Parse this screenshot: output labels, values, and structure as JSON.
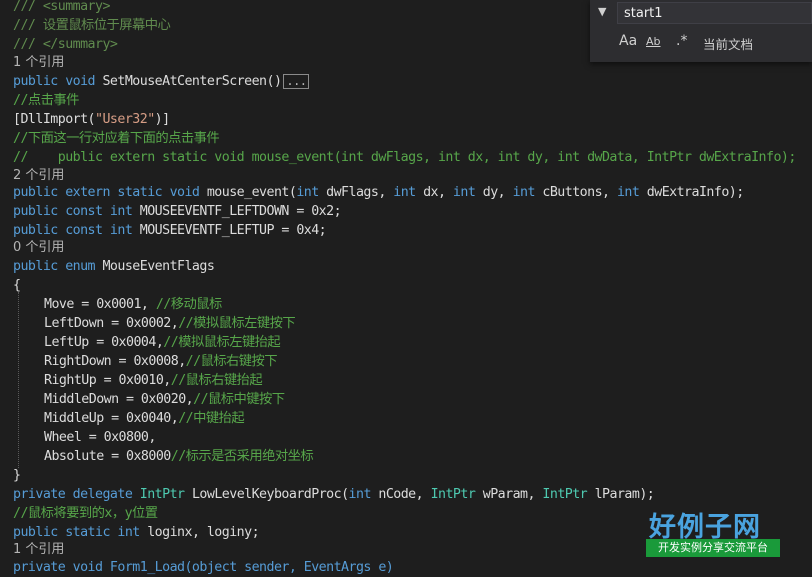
{
  "code": {
    "summary_open": "/// <summary>",
    "summary_text": "/// 设置鼠标位于屏幕中心",
    "summary_close": "/// </summary>",
    "ref_1": "1 个引用",
    "ref_2": "2 个引用",
    "ref_0": "0 个引用",
    "ref_last": "1 个引用",
    "line_setmouse": {
      "kw": "public void",
      "name": " SetMouseAtCenterScreen()",
      "collapsed": "..."
    },
    "comment_click": "//点击事件",
    "dllimport": {
      "open": "[DllImport(",
      "str": "\"User32\"",
      "close": ")]"
    },
    "comment_below": "//下面这一行对应着下面的点击事件",
    "comment_signature": "//    public extern static void mouse_event(int dwFlags, int dx, int dy, int dwData, IntPtr dwExtraInfo);",
    "line_mouse_event": {
      "kw": "public extern static void",
      "name": " mouse_event(",
      "t1": "int",
      "p1": " dwFlags, ",
      "t2": "int",
      "p2": " dx, ",
      "t3": "int",
      "p3": " dy, ",
      "t4": "int",
      "p4": " cButtons, ",
      "t5": "int",
      "p5": " dwExtraInfo);"
    },
    "line_leftdown": {
      "kw": "public const int",
      "rest": " MOUSEEVENTF_LEFTDOWN = 0x2;"
    },
    "line_leftup": {
      "kw": "public const int",
      "rest": " MOUSEEVENTF_LEFTUP = 0x4;"
    },
    "line_enum": {
      "kw": "public enum",
      "name": " MouseEventFlags"
    },
    "brace_open": "{",
    "brace_close": "}",
    "enum_members": [
      {
        "code": "Move = 0x0001, ",
        "comment": "//移动鼠标"
      },
      {
        "code": "LeftDown = 0x0002,",
        "comment": "//模拟鼠标左键按下"
      },
      {
        "code": "LeftUp = 0x0004,",
        "comment": "//模拟鼠标左键抬起"
      },
      {
        "code": "RightDown = 0x0008,",
        "comment": "//鼠标右键按下"
      },
      {
        "code": "RightUp = 0x0010,",
        "comment": "//鼠标右键抬起"
      },
      {
        "code": "MiddleDown = 0x0020,",
        "comment": "//鼠标中键按下"
      },
      {
        "code": "MiddleUp = 0x0040,",
        "comment": "//中键抬起"
      },
      {
        "code": "Wheel = 0x0800,",
        "comment": ""
      },
      {
        "code": "Absolute = 0x8000",
        "comment": "//标示是否采用绝对坐标"
      }
    ],
    "line_delegate": {
      "kw": "private delegate",
      "t0": " IntPtr",
      "name": " LowLevelKeyboardProc(",
      "t1": "int",
      "p1": " nCode, ",
      "t2": "IntPtr",
      "p2": " wParam, ",
      "t3": "IntPtr",
      "p3": " lParam);"
    },
    "comment_pos": "//鼠标将要到的x，y位置",
    "line_login": {
      "kw": "public static int",
      "rest": " loginx, loginy;"
    },
    "line_partial": "private void Form1_Load(object sender, EventArgs e)"
  },
  "find_widget": {
    "search_value": "start1",
    "toggle_icon": "chevron-down-icon",
    "scope_label": "当前文档",
    "match_case_label": "Aa",
    "match_word_label": "Ab",
    "regex_label": ".*"
  },
  "logo": {
    "main_text": "好例子网",
    "sub_text": "开发实例分享交流平台"
  }
}
